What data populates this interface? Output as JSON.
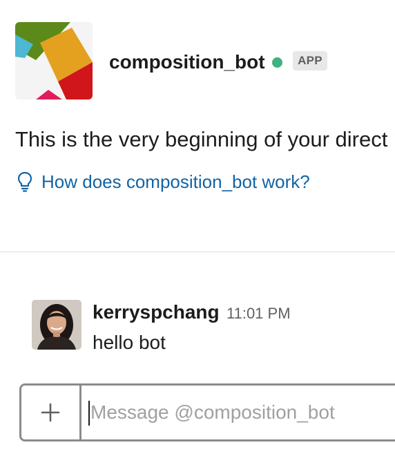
{
  "bot": {
    "name": "composition_bot",
    "badge": "APP",
    "presence_color": "#3fb27f",
    "logo_colors": [
      "#5b8a1a",
      "#4cb8d4",
      "#e3a11f",
      "#d0161a",
      "#e01e5a"
    ]
  },
  "intro": {
    "text": "This is the very beginning of your direct message history with composition_bot",
    "help_link": "How does composition_bot work?",
    "help_icon": "lightbulb-icon"
  },
  "message": {
    "author": "kerryspchang",
    "time": "11:01 PM",
    "text": "hello bot"
  },
  "composer": {
    "placeholder": "Message @composition_bot",
    "add_icon": "plus-icon"
  },
  "colors": {
    "link": "#1264a3",
    "text": "#1d1c1d",
    "muted": "#616061"
  }
}
